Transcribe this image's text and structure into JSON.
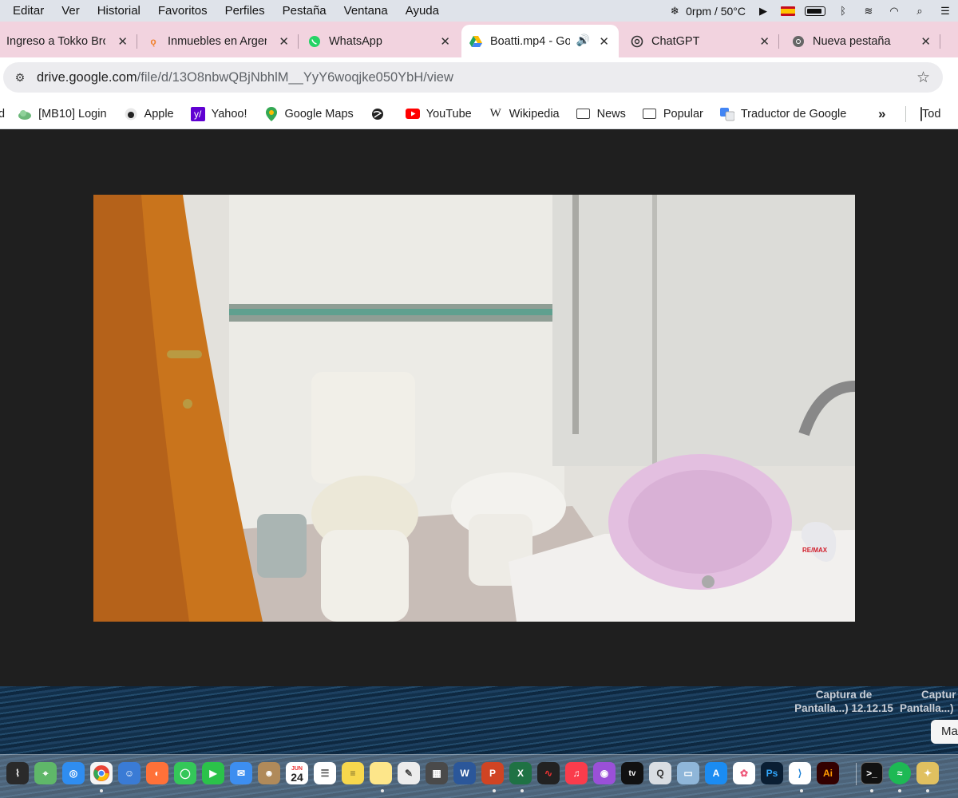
{
  "menubar": {
    "items": [
      "Editar",
      "Ver",
      "Historial",
      "Favoritos",
      "Perfiles",
      "Pestaña",
      "Ventana",
      "Ayuda"
    ],
    "fan_status": "0rpm / 50°C"
  },
  "tabs": [
    {
      "title": "Ingreso a Tokko Bro",
      "close": "✕",
      "icon": "tokko-favicon"
    },
    {
      "title": "Inmuebles en Argen",
      "close": "✕",
      "icon": "pin-favicon"
    },
    {
      "title": "WhatsApp",
      "close": "✕",
      "icon": "whatsapp-favicon"
    },
    {
      "title": "Boatti.mp4 - Go",
      "close": "✕",
      "icon": "google-drive-favicon",
      "audio": "🔊"
    },
    {
      "title": "ChatGPT",
      "close": "✕",
      "icon": "chatgpt-favicon"
    },
    {
      "title": "Nueva pestaña",
      "close": "✕",
      "icon": "chrome-favicon"
    }
  ],
  "address": {
    "host": "drive.google.com",
    "path": "/file/d/13O8nbwQBjNbhlM__YyY6woqjke050YbH/view"
  },
  "bookmarks": {
    "items": [
      {
        "label": "[MB10] Login",
        "icon": "cloud-icon"
      },
      {
        "label": "Apple",
        "icon": "apple-icon"
      },
      {
        "label": "Yahoo!",
        "icon": "yahoo-icon"
      },
      {
        "label": "Google Maps",
        "icon": "maps-pin-icon"
      },
      {
        "label": "",
        "icon": "globe-icon"
      },
      {
        "label": "YouTube",
        "icon": "youtube-icon"
      },
      {
        "label": "Wikipedia",
        "icon": "wikipedia-icon"
      },
      {
        "label": "News",
        "icon": "folder-icon"
      },
      {
        "label": "Popular",
        "icon": "folder-icon"
      },
      {
        "label": "Traductor de Google",
        "icon": "translate-icon"
      }
    ],
    "more": "»",
    "other": "Tod"
  },
  "video": {
    "watermark": "RE/MAX"
  },
  "desktop": {
    "files": [
      {
        "line1": "Captura de",
        "line2": "Pantalla...) 12.12.15"
      },
      {
        "line1": "Captur",
        "line2": "Pantalla...)"
      }
    ],
    "button": "Ma"
  },
  "dock": {
    "calendar_month": "JUN",
    "calendar_day": "24",
    "apps": [
      "activity-monitor",
      "maps",
      "safari",
      "chrome",
      "finder-alt",
      "firefox",
      "messages",
      "facetime",
      "mail",
      "contacts",
      "calendar",
      "reminders",
      "notes",
      "stickies",
      "textedit",
      "calculator",
      "word",
      "powerpoint",
      "excel",
      "voice-memos",
      "music",
      "podcasts",
      "tv",
      "quicktime",
      "preview",
      "app-store",
      "photos",
      "photoshop",
      "vscode",
      "illustrator",
      "terminal",
      "spotify",
      "utility"
    ]
  }
}
